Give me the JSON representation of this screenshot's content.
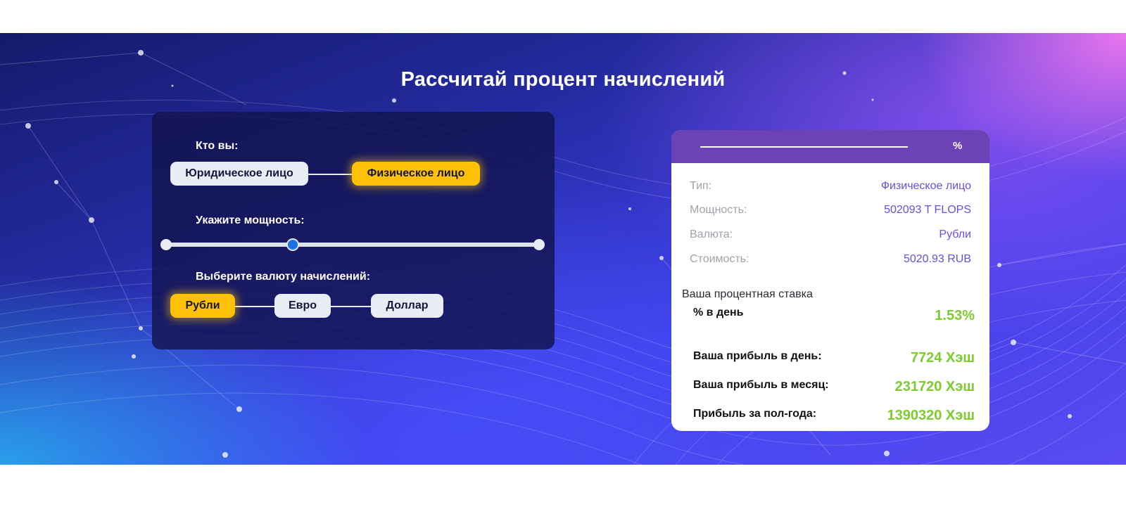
{
  "title": "Рассчитай процент начислений",
  "calculator": {
    "who_label": "Кто вы:",
    "entity_options": [
      "Юридическое лицо",
      "Физическое лицо"
    ],
    "entity_selected": "Физическое лицо",
    "power_label": "Укажите мощность:",
    "power_slider_fraction": 0.34,
    "currency_label": "Выберите валюту начислений:",
    "currency_options": [
      "Рубли",
      "Евро",
      "Доллар"
    ],
    "currency_selected": "Рубли"
  },
  "result": {
    "header_symbol": "%",
    "rows": [
      {
        "key": "Тип:",
        "value": "Физическое лицо"
      },
      {
        "key": "Мощность:",
        "value": "502093 T FLOPS"
      },
      {
        "key": "Валюта:",
        "value": "Рубли"
      },
      {
        "key": "Стоимость:",
        "value": "5020.93 RUB"
      }
    ],
    "rate_caption": "Ваша процентная ставка",
    "daily_rate_label": "% в день",
    "daily_rate_value": "1.53%",
    "profit_day_label": "Ваша прибыль в день:",
    "profit_day_value": "7724 Хэш",
    "profit_month_label": "Ваша прибыль в месяц:",
    "profit_month_value": "231720 Хэш",
    "profit_half_year_label": "Прибыль за пол-года:",
    "profit_half_year_value": "1390320 Хэш"
  },
  "colors": {
    "accent_yellow": "#ffc107",
    "accent_purple": "#6b43b6",
    "value_purple": "#6a4de6",
    "profit_green": "#7ccc2a",
    "slider_thumb": "#1a73e8"
  }
}
